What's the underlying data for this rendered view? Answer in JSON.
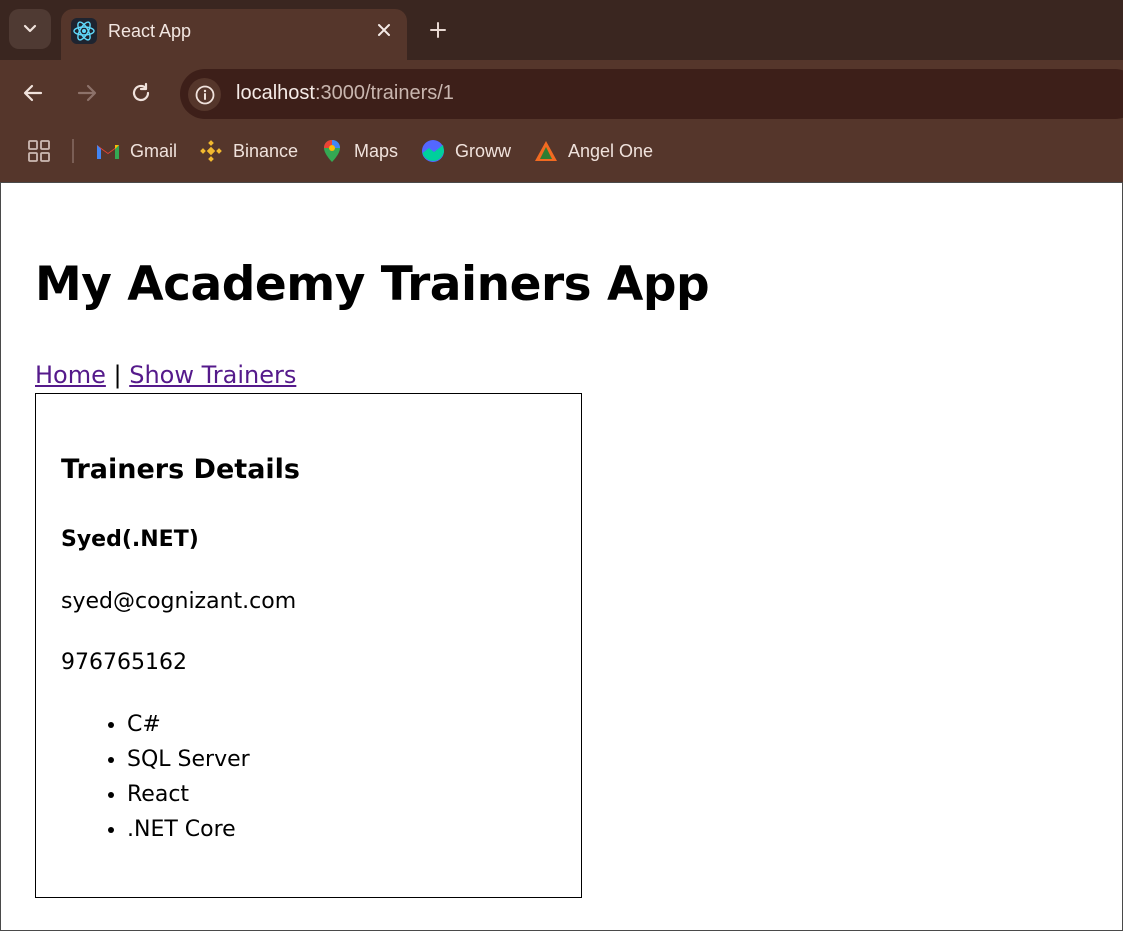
{
  "browser": {
    "tab_title": "React App",
    "tab_close_glyph": "✕",
    "new_tab_glyph": "+",
    "url_host": "localhost",
    "url_rest": ":3000/trainers/1",
    "bookmarks": [
      {
        "label": "Gmail",
        "icon": "gmail-icon"
      },
      {
        "label": "Binance",
        "icon": "binance-icon"
      },
      {
        "label": "Maps",
        "icon": "maps-icon"
      },
      {
        "label": "Groww",
        "icon": "groww-icon"
      },
      {
        "label": "Angel One",
        "icon": "angel-one-icon"
      }
    ],
    "colors": {
      "tab_strip": "#3a2620",
      "toolbar": "#55362b",
      "omnibox": "#3d1f19"
    }
  },
  "page": {
    "title": "My Academy Trainers App",
    "nav": {
      "home": "Home",
      "separator": " | ",
      "show_trainers": "Show Trainers"
    },
    "details": {
      "heading": "Trainers Details",
      "name": "Syed(.NET)",
      "email": "syed@cognizant.com",
      "phone": "976765162",
      "skills": [
        "C#",
        "SQL Server",
        "React",
        ".NET Core"
      ]
    },
    "colors": {
      "visited_link": "#551a8b"
    }
  }
}
